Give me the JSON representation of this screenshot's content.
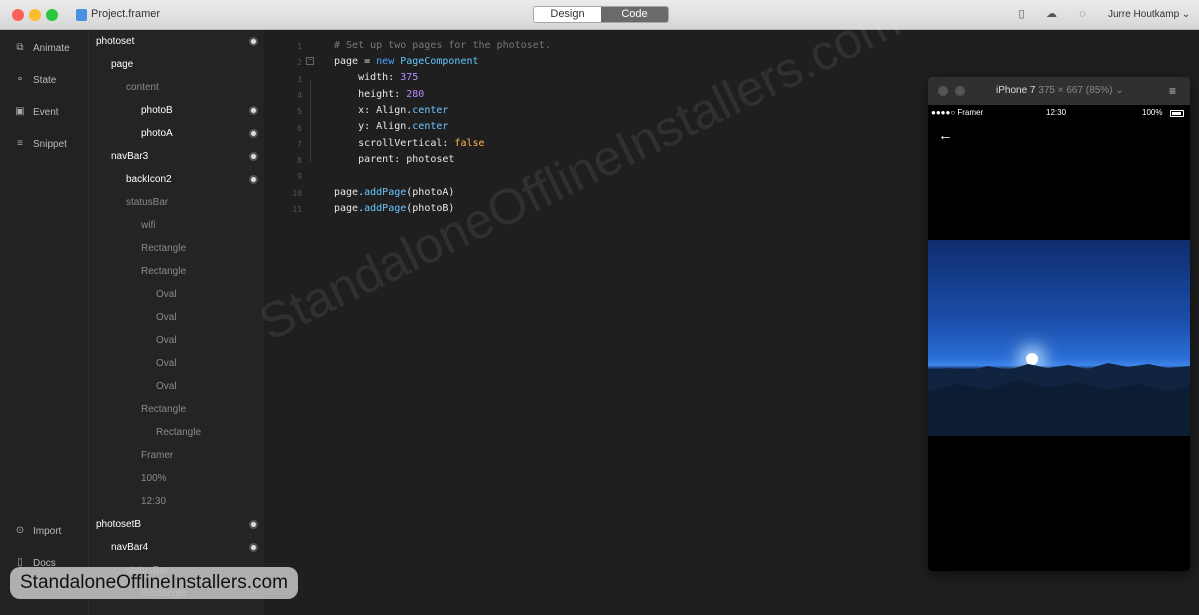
{
  "window": {
    "title": "Project.framer",
    "user": "Jurre Houtkamp",
    "user_caret": "⌄"
  },
  "mode": {
    "design": "Design",
    "code": "Code"
  },
  "nav": {
    "animate": "Animate",
    "state": "State",
    "event": "Event",
    "snippet": "Snippet",
    "import": "Import",
    "docs": "Docs"
  },
  "layers": [
    {
      "label": "photoset",
      "level": 0,
      "active": true,
      "dot": true
    },
    {
      "label": "page",
      "level": 1,
      "active": true,
      "dot": false
    },
    {
      "label": "content",
      "level": 2,
      "active": false,
      "dot": false
    },
    {
      "label": "photoB",
      "level": 3,
      "active": true,
      "dot": true
    },
    {
      "label": "photoA",
      "level": 3,
      "active": true,
      "dot": true
    },
    {
      "label": "navBar3",
      "level": 1,
      "active": true,
      "dot": true
    },
    {
      "label": "backIcon2",
      "level": 2,
      "active": true,
      "dot": true
    },
    {
      "label": "statusBar",
      "level": 2,
      "active": false,
      "dot": false
    },
    {
      "label": "wifi",
      "level": 3,
      "active": false,
      "dot": false
    },
    {
      "label": "Rectangle",
      "level": 3,
      "active": false,
      "dot": false
    },
    {
      "label": "Rectangle",
      "level": 3,
      "active": false,
      "dot": false
    },
    {
      "label": "Oval",
      "level": 4,
      "active": false,
      "dot": false
    },
    {
      "label": "Oval",
      "level": 4,
      "active": false,
      "dot": false
    },
    {
      "label": "Oval",
      "level": 4,
      "active": false,
      "dot": false
    },
    {
      "label": "Oval",
      "level": 4,
      "active": false,
      "dot": false
    },
    {
      "label": "Oval",
      "level": 4,
      "active": false,
      "dot": false
    },
    {
      "label": "Rectangle",
      "level": 3,
      "active": false,
      "dot": false
    },
    {
      "label": "Rectangle",
      "level": 4,
      "active": false,
      "dot": false
    },
    {
      "label": "Framer",
      "level": 3,
      "active": false,
      "dot": false
    },
    {
      "label": "100%",
      "level": 3,
      "active": false,
      "dot": false
    },
    {
      "label": "12:30",
      "level": 3,
      "active": false,
      "dot": false
    },
    {
      "label": "photosetB",
      "level": 0,
      "active": true,
      "dot": true
    },
    {
      "label": "navBar4",
      "level": 1,
      "active": true,
      "dot": true
    },
    {
      "label": "statusBar",
      "level": 2,
      "active": false,
      "dot": false
    },
    {
      "label": "Rectangle",
      "level": 3,
      "active": false,
      "dot": false
    }
  ],
  "code": {
    "line_numbers": [
      "1",
      "2",
      "3",
      "4",
      "5",
      "6",
      "7",
      "8",
      "9",
      "10",
      "11"
    ],
    "l1": "# Set up two pages for the photoset.",
    "l2_a": "page = ",
    "l2_b": "new",
    "l2_c": " PageComponent",
    "l3_a": "    width: ",
    "l3_b": "375",
    "l4_a": "    height: ",
    "l4_b": "280",
    "l5_a": "    x: Align.",
    "l5_b": "center",
    "l6_a": "    y: Align.",
    "l6_b": "center",
    "l7_a": "    scrollVertical: ",
    "l7_b": "false",
    "l8": "    parent: photoset",
    "l10_a": "page.",
    "l10_b": "addPage",
    "l10_c": "(photoA)",
    "l11_a": "page.",
    "l11_b": "addPage",
    "l11_c": "(photoB)"
  },
  "device": {
    "name": "iPhone 7",
    "size": "375 × 667 (85%)",
    "caret": "⌄",
    "carrier": "●●●●○ Framer",
    "time": "12:30",
    "battery": "100%"
  },
  "watermark": {
    "text": "StandaloneOfflineInstallers.com",
    "badge": "StandaloneOfflineInstallers.com"
  }
}
